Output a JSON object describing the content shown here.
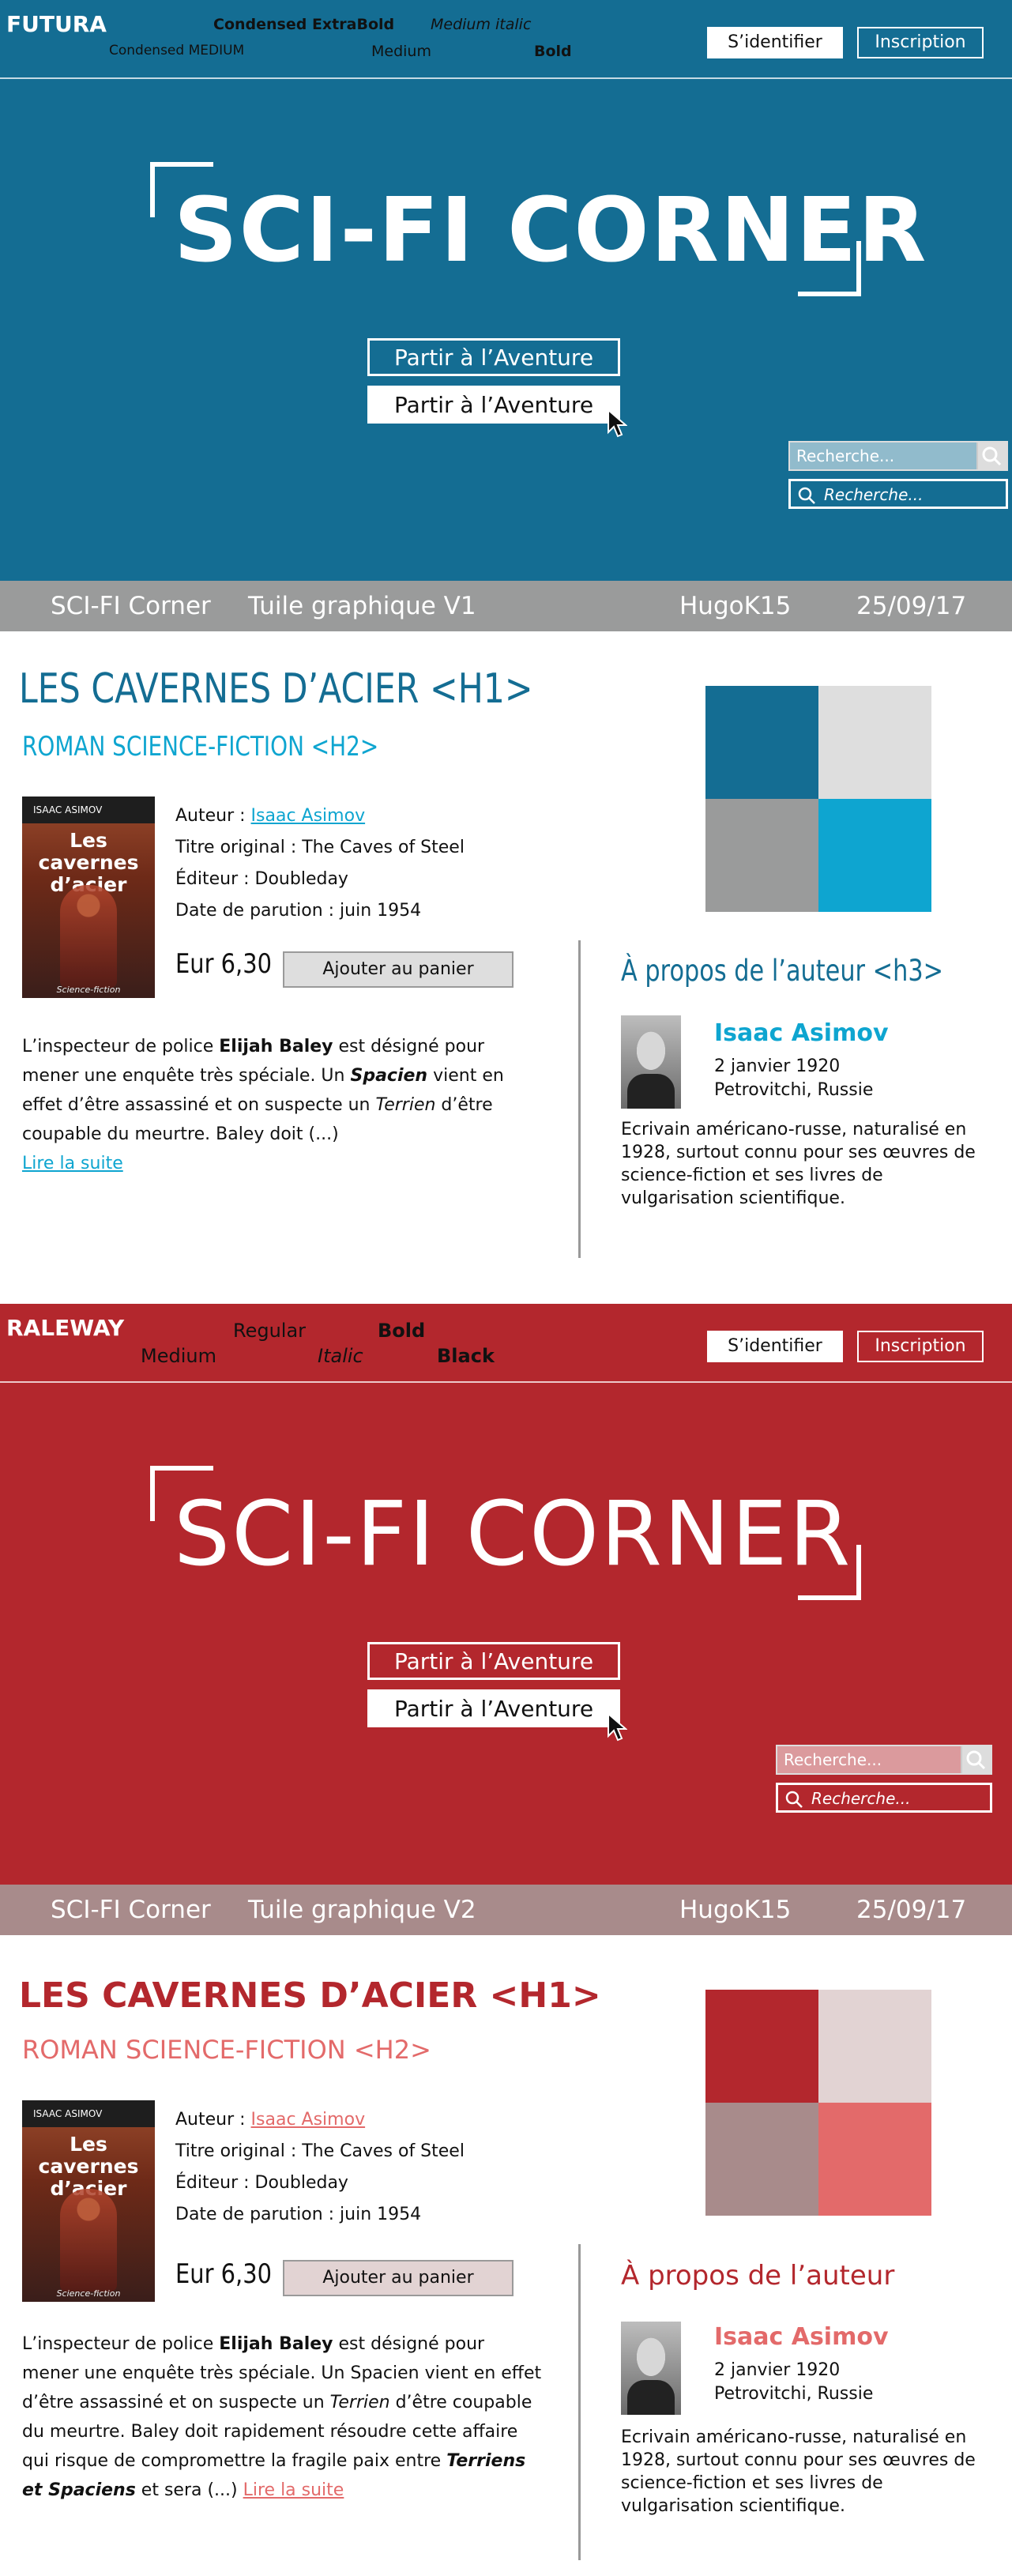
{
  "colors": {
    "v1_primary": "#146d93",
    "v1_accent": "#0ea5d0",
    "v1_grey": "#9a9b9b",
    "v1_light": "#dedede",
    "v2_primary": "#b3272d",
    "v2_accent": "#e36a6a",
    "v2_grey": "#a88b8b",
    "v2_light": "#e2d3d3"
  },
  "icons": [
    "cursor-icon",
    "search-icon"
  ],
  "v1": {
    "font_name": "FUTURA",
    "weights": [
      "Condensed ExtraBold",
      "Medium italic",
      "Condensed MEDIUM",
      "Medium",
      "Bold"
    ],
    "login": "S’identifier",
    "signup": "Inscription",
    "logo": "SCI-FI CORNER",
    "cta_outline": "Partir à l’Aventure",
    "cta_solid": "Partir à l’Aventure",
    "search_placeholder": "Recherche...",
    "bar": {
      "site": "SCI-FI Corner",
      "tile": "Tuile graphique V1",
      "author": "HugoK15",
      "date": "25/09/17"
    },
    "h1": "LES CAVERNES D’ACIER <H1>",
    "h2": "ROMAN SCIENCE-FICTION <H2>",
    "book": {
      "cover_author": "ISAAC ASIMOV",
      "cover_title": "Les cavernes d’acier",
      "cover_series": "Science-fiction"
    },
    "meta": {
      "author_label": "Auteur : ",
      "author": "Isaac Asimov",
      "original": "Titre original : The Caves of Steel",
      "publisher": "Éditeur : Doubleday",
      "date": "Date de parution : juin 1954"
    },
    "price": "Eur 6,30",
    "cart": "Ajouter au panier",
    "desc": {
      "p1": "L’inspecteur de police ",
      "b1": "Elijah Baley",
      "p2": " est désigné pour mener une enquête très spéciale. Un ",
      "b2": "Spacien",
      "p3": " vient en effet d’être assassiné et on suspecte un ",
      "i1": "Terrien",
      "p4": " d’être coupable du meurtre. Baley doit (...)",
      "more": "Lire la suite"
    },
    "h3": "À propos de l’auteur <h3>",
    "about": {
      "name": "Isaac Asimov",
      "born": "2 janvier 1920",
      "place": "Petrovitchi, Russie",
      "bio": "Ecrivain américano-russe, naturalisé en 1928, surtout connu pour ses œuvres de science-fiction et ses livres de vulgarisation scientifique."
    }
  },
  "v2": {
    "font_name": "RALEWAY",
    "weights": [
      "Regular",
      "Bold",
      "Medium",
      "Italic",
      "Black"
    ],
    "login": "S’identifier",
    "signup": "Inscription",
    "logo": "SCI-FI CORNER",
    "cta_outline": "Partir à l’Aventure",
    "cta_solid": "Partir à l’Aventure",
    "search_placeholder": "Recherche...",
    "bar": {
      "site": "SCI-FI Corner",
      "tile": "Tuile graphique V2",
      "author": "HugoK15",
      "date": "25/09/17"
    },
    "h1": "LES CAVERNES D’ACIER <H1>",
    "h2": "ROMAN SCIENCE-FICTION <H2>",
    "book": {
      "cover_author": "ISAAC ASIMOV",
      "cover_title": "Les cavernes d’acier",
      "cover_series": "Science-fiction"
    },
    "meta": {
      "author_label": "Auteur : ",
      "author": "Isaac Asimov",
      "original": "Titre original : The Caves of Steel",
      "publisher": "Éditeur : Doubleday",
      "date": "Date de parution : juin 1954"
    },
    "price": "Eur 6,30",
    "cart": "Ajouter au panier",
    "desc": {
      "p1": "L’inspecteur de police ",
      "b1": "Elijah Baley",
      "p2": " est désigné pour mener une enquête très spéciale. Un Spacien vient en effet d’être assassiné et on suspecte un ",
      "i1": "Terrien",
      "p3": " d’être coupable du meurtre. Baley doit rapidement résoudre cette affaire qui risque de compromettre la fragile paix entre ",
      "b2": "Terriens et Spaciens",
      "p4": " et sera (...) ",
      "more": "Lire la suite"
    },
    "h3": "À propos de l’auteur",
    "about": {
      "name": "Isaac Asimov",
      "born": "2 janvier 1920",
      "place": "Petrovitchi, Russie",
      "bio": "Ecrivain américano-russe, naturalisé en 1928, surtout connu pour ses œuvres de science-fiction et ses livres de vulgarisation scientifique."
    }
  }
}
